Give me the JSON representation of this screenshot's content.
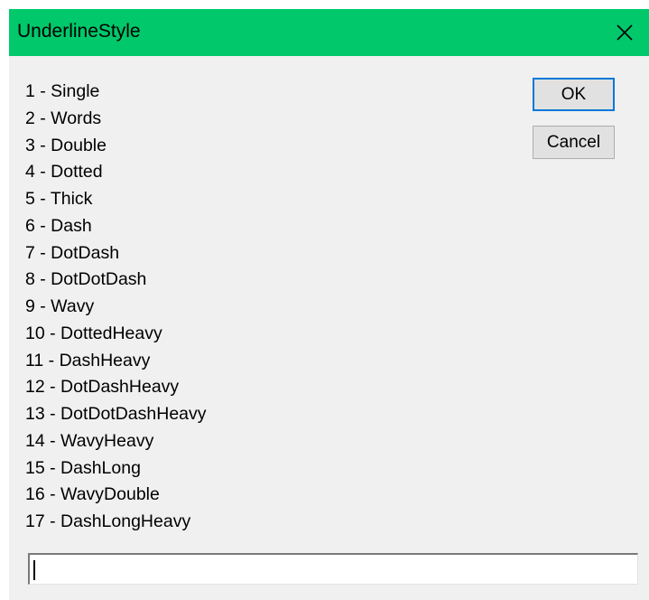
{
  "window": {
    "title": "UnderlineStyle",
    "titlebar_color": "#00c86b",
    "close_icon": "close-icon"
  },
  "options": [
    "1 - Single",
    "2 - Words",
    "3 - Double",
    "4 - Dotted",
    "5 - Thick",
    "6 - Dash",
    "7 - DotDash",
    "8 - DotDotDash",
    "9 - Wavy",
    "10 - DottedHeavy",
    "11 - DashHeavy",
    "12 - DotDashHeavy",
    "13 - DotDotDashHeavy",
    "14 - WavyHeavy",
    "15 - DashLong",
    "16 - WavyDouble",
    "17 - DashLongHeavy"
  ],
  "buttons": {
    "ok_label": "OK",
    "cancel_label": "Cancel",
    "default_border_color": "#0078d7"
  },
  "input": {
    "value": "",
    "placeholder": ""
  }
}
